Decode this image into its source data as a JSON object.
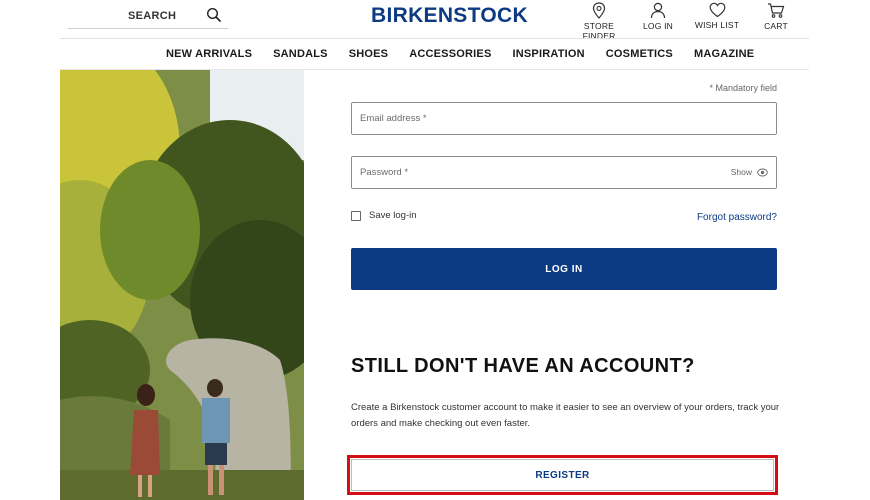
{
  "header": {
    "search_label": "SEARCH",
    "search_icon": "search-icon",
    "logo": "BIRKENSTOCK",
    "links": [
      {
        "label": "STORE FINDER",
        "icon": "location-pin-icon"
      },
      {
        "label": "LOG IN",
        "icon": "user-icon"
      },
      {
        "label": "WISH LIST",
        "icon": "heart-icon"
      },
      {
        "label": "CART",
        "icon": "cart-icon"
      }
    ]
  },
  "nav": {
    "items": [
      "NEW ARRIVALS",
      "SANDALS",
      "SHOES",
      "ACCESSORIES",
      "INSPIRATION",
      "COSMETICS",
      "MAGAZINE"
    ]
  },
  "form": {
    "mandatory_note": "* Mandatory field",
    "email_placeholder": "Email address *",
    "password_placeholder": "Password *",
    "show_label": "Show",
    "save_login_label": "Save log-in",
    "forgot_password": "Forgot password?",
    "login_button": "LOG IN"
  },
  "register": {
    "heading": "STILL DON'T HAVE AN ACCOUNT?",
    "description": "Create a Birkenstock customer account to make it easier to see an overview of your orders, track your orders and make checking out even faster.",
    "button": "REGISTER"
  },
  "colors": {
    "brand": "#0d3b83",
    "highlight": "#d40f14"
  }
}
